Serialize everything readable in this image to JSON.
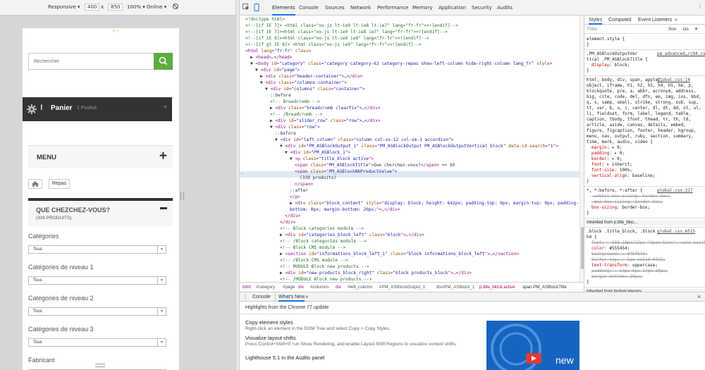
{
  "device_toolbar": {
    "mode": "Responsive ▾",
    "width": "400",
    "times": "x",
    "height": "850",
    "zoom": "100% ▾",
    "network": "Online ▾"
  },
  "tabs": [
    "Elements",
    "Console",
    "Sources",
    "Network",
    "Performance",
    "Memory",
    "Application",
    "Security",
    "Audits"
  ],
  "styles_tabs": [
    "Styles",
    "Computed",
    "Event Listeners",
    "»"
  ],
  "filter_placeholder": "Filter",
  "filter_hov": ":hov",
  "filter_cls": ".cls",
  "filter_plus": "+",
  "device_page": {
    "logo_fragment": "ᵒ⁻ᶦ",
    "search_placeholder": "Rechercher",
    "cart_label": "Panier",
    "cart_count": "1 Produit",
    "menu_label": "MENU",
    "breadcrumb_item": "Repas",
    "filter_title": "QUE CHEZCHEZ-VOUS?",
    "filter_count": "(339 PRODUITS)",
    "filters": [
      {
        "label": "Catégories",
        "value": "Tous"
      },
      {
        "label": "Catégories de niveau 1",
        "value": "Tous"
      },
      {
        "label": "Catégories de niveau 2",
        "value": "Tous"
      },
      {
        "label": "Catégories de niveau 3",
        "value": "Tous"
      },
      {
        "label": "Fabricant",
        "value": "Tous"
      }
    ]
  },
  "dom_lines": [
    [
      {
        "c": "cm",
        "t": "<!doctype html>"
      }
    ],
    [
      {
        "c": "cm",
        "t": "<!--[if IE 7]> <html class=\"no-js lt-ie9 lt-ie8 lt-ie7\" lang=\"fr-fr\"><![endif]-->"
      }
    ],
    [
      {
        "c": "cm",
        "t": "<!--[if IE 7]><html class=\"no-js lt-ie9 lt-ie8 ie7\" lang=\"fr-fr\"><![endif]-->"
      }
    ],
    [
      {
        "c": "cm",
        "t": "<!--[if IE 8]><html class=\"no-js lt-ie9 ie8\" lang=\"fr-fr\"><![endif]-->"
      }
    ],
    [
      {
        "c": "cm",
        "t": "<!--[if gt IE 8]> <html class=\"no-js ie9\" lang=\"fr-fr\"><![endif]-->"
      }
    ],
    [
      {
        "c": "tag",
        "t": "<html "
      },
      {
        "c": "an",
        "t": "lang"
      },
      {
        "c": "tag",
        "t": "="
      },
      {
        "c": "av",
        "t": "\"fr-fr\""
      },
      {
        "c": "tag",
        "t": " "
      },
      {
        "c": "an",
        "t": "class"
      },
      {
        "c": "tag",
        "t": ">"
      }
    ],
    [
      {
        "c": "tx",
        "t": "▶ "
      },
      {
        "c": "tag",
        "t": "<head>…</head>"
      }
    ],
    [
      {
        "c": "tx",
        "t": "▼ "
      },
      {
        "c": "tag",
        "t": "<body "
      },
      {
        "c": "an",
        "t": "id"
      },
      {
        "c": "tag",
        "t": "="
      },
      {
        "c": "av",
        "t": "\"category\""
      },
      {
        "c": "tag",
        "t": " "
      },
      {
        "c": "an",
        "t": "class"
      },
      {
        "c": "tag",
        "t": "="
      },
      {
        "c": "av",
        "t": "\"category category-62 category-repas show-left-column hide-right-column lang_fr\""
      },
      {
        "c": "tag",
        "t": " "
      },
      {
        "c": "an",
        "t": "style"
      },
      {
        "c": "tag",
        "t": ">"
      }
    ],
    [
      {
        "c": "tx",
        "t": "▼ "
      },
      {
        "c": "tag",
        "t": "<div "
      },
      {
        "c": "an",
        "t": "id"
      },
      {
        "c": "tag",
        "t": "="
      },
      {
        "c": "av",
        "t": "\"page\""
      },
      {
        "c": "tag",
        "t": ">"
      }
    ],
    [
      {
        "c": "tx",
        "t": "▶ "
      },
      {
        "c": "tag",
        "t": "<div "
      },
      {
        "c": "an",
        "t": "class"
      },
      {
        "c": "tag",
        "t": "="
      },
      {
        "c": "av",
        "t": "\"header-container\""
      },
      {
        "c": "tag",
        "t": ">…</div>"
      }
    ],
    [
      {
        "c": "tx",
        "t": "▼ "
      },
      {
        "c": "tag",
        "t": "<div "
      },
      {
        "c": "an",
        "t": "class"
      },
      {
        "c": "tag",
        "t": "="
      },
      {
        "c": "av",
        "t": "\"columns-container\""
      },
      {
        "c": "tag",
        "t": ">"
      }
    ],
    [
      {
        "c": "tx",
        "t": "▼ "
      },
      {
        "c": "tag",
        "t": "<div "
      },
      {
        "c": "an",
        "t": "id"
      },
      {
        "c": "tag",
        "t": "="
      },
      {
        "c": "av",
        "t": "\"columns\""
      },
      {
        "c": "tag",
        "t": " "
      },
      {
        "c": "an",
        "t": "class"
      },
      {
        "c": "tag",
        "t": "="
      },
      {
        "c": "av",
        "t": "\"container\""
      },
      {
        "c": "tag",
        "t": ">"
      }
    ],
    [
      {
        "c": "tx",
        "t": "::before"
      }
    ],
    [
      {
        "c": "cm",
        "t": "<!-- Breadcrumb -->"
      }
    ],
    [
      {
        "c": "tx",
        "t": "▶ "
      },
      {
        "c": "tag",
        "t": "<div "
      },
      {
        "c": "an",
        "t": "class"
      },
      {
        "c": "tag",
        "t": "="
      },
      {
        "c": "av",
        "t": "\"breadcrumb clearfix\""
      },
      {
        "c": "tag",
        "t": ">…</div>"
      }
    ],
    [
      {
        "c": "cm",
        "t": "<!-- /Breadcrumb -->"
      }
    ],
    [
      {
        "c": "tx",
        "t": "▶ "
      },
      {
        "c": "tag",
        "t": "<div "
      },
      {
        "c": "an",
        "t": "id"
      },
      {
        "c": "tag",
        "t": "="
      },
      {
        "c": "av",
        "t": "\"slider_row\""
      },
      {
        "c": "tag",
        "t": " "
      },
      {
        "c": "an",
        "t": "class"
      },
      {
        "c": "tag",
        "t": "="
      },
      {
        "c": "av",
        "t": "\"row\""
      },
      {
        "c": "tag",
        "t": ">…</div>"
      }
    ],
    [
      {
        "c": "tx",
        "t": "▼ "
      },
      {
        "c": "tag",
        "t": "<div "
      },
      {
        "c": "an",
        "t": "class"
      },
      {
        "c": "tag",
        "t": "="
      },
      {
        "c": "av",
        "t": "\"row\""
      },
      {
        "c": "tag",
        "t": ">"
      }
    ],
    [
      {
        "c": "tx",
        "t": "::before"
      }
    ],
    [
      {
        "c": "tx",
        "t": "▼ "
      },
      {
        "c": "tag",
        "t": "<div "
      },
      {
        "c": "an",
        "t": "id"
      },
      {
        "c": "tag",
        "t": "="
      },
      {
        "c": "av",
        "t": "\"left_column\""
      },
      {
        "c": "tag",
        "t": " "
      },
      {
        "c": "an",
        "t": "class"
      },
      {
        "c": "tag",
        "t": "="
      },
      {
        "c": "av",
        "t": "\"column col-xs-12 col-sm-3 accordion\""
      },
      {
        "c": "tag",
        "t": ">"
      }
    ],
    [
      {
        "c": "tx",
        "t": "▼ "
      },
      {
        "c": "tag",
        "t": "<div "
      },
      {
        "c": "an",
        "t": "id"
      },
      {
        "c": "tag",
        "t": "="
      },
      {
        "c": "av",
        "t": "\"PM_ASBlockOutput_1\""
      },
      {
        "c": "tag",
        "t": " "
      },
      {
        "c": "an",
        "t": "class"
      },
      {
        "c": "tag",
        "t": "="
      },
      {
        "c": "av",
        "t": "\"PM_ASBlockOutput PM_ASBlockOutputVertical block\""
      },
      {
        "c": "tag",
        "t": " "
      },
      {
        "c": "an",
        "t": "data-id-search"
      },
      {
        "c": "tag",
        "t": "="
      },
      {
        "c": "av",
        "t": "\"1\""
      },
      {
        "c": "tag",
        "t": ">"
      }
    ],
    [
      {
        "c": "tx",
        "t": "▼ "
      },
      {
        "c": "tag",
        "t": "<div "
      },
      {
        "c": "an",
        "t": "id"
      },
      {
        "c": "tag",
        "t": "="
      },
      {
        "c": "av",
        "t": "\"PM_ASBlock_1\""
      },
      {
        "c": "tag",
        "t": ">"
      }
    ],
    [
      {
        "c": "tx",
        "t": "▼ "
      },
      {
        "c": "tag",
        "t": "<p "
      },
      {
        "c": "an",
        "t": "class"
      },
      {
        "c": "tag",
        "t": "="
      },
      {
        "c": "av",
        "t": "\"title_block active\""
      },
      {
        "c": "tag",
        "t": ">"
      }
    ],
    [
      {
        "c": "tag",
        "t": "<span "
      },
      {
        "c": "an",
        "t": "class"
      },
      {
        "c": "tag",
        "t": "="
      },
      {
        "c": "av",
        "t": "\"PM_ASBlockTitle\""
      },
      {
        "c": "tag",
        "t": ">"
      },
      {
        "c": "tx",
        "t": "Que cherchez-vous?"
      },
      {
        "c": "tag",
        "t": "</span>"
      },
      {
        "c": "tx",
        "t": " == $0"
      }
    ],
    [
      {
        "c": "tag",
        "t": "<span "
      },
      {
        "c": "an",
        "t": "class"
      },
      {
        "c": "tag",
        "t": "="
      },
      {
        "c": "av",
        "t": "\"PM_ASBlockNbProductValue\""
      },
      {
        "c": "tag",
        "t": ">"
      }
    ],
    [
      {
        "c": "tx",
        "t": "(339 produits)"
      }
    ],
    [
      {
        "c": "tag",
        "t": "</span>"
      }
    ],
    [
      {
        "c": "tx",
        "t": "::after"
      }
    ],
    [
      {
        "c": "tag",
        "t": "</p>"
      }
    ],
    [
      {
        "c": "tx",
        "t": "▶ "
      },
      {
        "c": "tag",
        "t": "<div "
      },
      {
        "c": "an",
        "t": "class"
      },
      {
        "c": "tag",
        "t": "="
      },
      {
        "c": "av",
        "t": "\"block_content\""
      },
      {
        "c": "tag",
        "t": " "
      },
      {
        "c": "an",
        "t": "style"
      },
      {
        "c": "tag",
        "t": "="
      },
      {
        "c": "av",
        "t": "\"display: block; height: 642px; padding-top: 0px; margin-top: 0px; padding-"
      }
    ],
    [
      {
        "c": "av",
        "t": "bottom: 0px; margin-bottom: 20px;\""
      },
      {
        "c": "tag",
        "t": ">…</div>"
      }
    ],
    [
      {
        "c": "tag",
        "t": "</div>"
      }
    ],
    [
      {
        "c": "tag",
        "t": "</div>"
      }
    ],
    [
      {
        "c": "cm",
        "t": "<!-- Block categories module -->"
      }
    ],
    [
      {
        "c": "tx",
        "t": "▶ "
      },
      {
        "c": "tag",
        "t": "<div "
      },
      {
        "c": "an",
        "t": "id"
      },
      {
        "c": "tag",
        "t": "="
      },
      {
        "c": "av",
        "t": "\"categories_block_left\""
      },
      {
        "c": "tag",
        "t": " "
      },
      {
        "c": "an",
        "t": "class"
      },
      {
        "c": "tag",
        "t": "="
      },
      {
        "c": "av",
        "t": "\"block\""
      },
      {
        "c": "tag",
        "t": ">…</div>"
      }
    ],
    [
      {
        "c": "cm",
        "t": "<!-- /Block categories module -->"
      }
    ],
    [
      {
        "c": "cm",
        "t": "<!-- Block CMS module -->"
      }
    ],
    [
      {
        "c": "tx",
        "t": "▶ "
      },
      {
        "c": "tag",
        "t": "<section "
      },
      {
        "c": "an",
        "t": "id"
      },
      {
        "c": "tag",
        "t": "="
      },
      {
        "c": "av",
        "t": "\"informations_block_left_1\""
      },
      {
        "c": "tag",
        "t": " "
      },
      {
        "c": "an",
        "t": "class"
      },
      {
        "c": "tag",
        "t": "="
      },
      {
        "c": "av",
        "t": "\"block informations_block_left\""
      },
      {
        "c": "tag",
        "t": ">…</section>"
      }
    ],
    [
      {
        "c": "cm",
        "t": "<!-- /Block CMS module -->"
      }
    ],
    [
      {
        "c": "cm",
        "t": "<!-- MODULE Block new products -->"
      }
    ],
    [
      {
        "c": "tx",
        "t": "▶ "
      },
      {
        "c": "tag",
        "t": "<div "
      },
      {
        "c": "an",
        "t": "id"
      },
      {
        "c": "tag",
        "t": "="
      },
      {
        "c": "av",
        "t": "\"new-products_block_right\""
      },
      {
        "c": "tag",
        "t": " "
      },
      {
        "c": "an",
        "t": "class"
      },
      {
        "c": "tag",
        "t": "="
      },
      {
        "c": "av",
        "t": "\"block products_block\""
      },
      {
        "c": "tag",
        "t": ">…</div>"
      }
    ],
    [
      {
        "c": "cm",
        "t": "<!-- /MODULE Block new products -->"
      }
    ],
    [
      {
        "c": "cm",
        "t": "<!-- Block stores module -->"
      }
    ]
  ],
  "dom_indent": [
    0,
    0,
    0,
    0,
    0,
    0,
    1,
    1,
    2,
    3,
    3,
    4,
    5,
    5,
    5,
    5,
    5,
    5,
    6,
    6,
    7,
    8,
    9,
    10,
    10,
    11,
    10,
    9,
    9,
    9,
    9,
    8,
    7,
    7,
    7,
    7,
    7,
    7,
    7,
    7,
    7,
    7
  ],
  "breadcrumb": [
    "html",
    "#category",
    "#page",
    "div",
    "#columns",
    "div",
    "#left_column",
    "#PM_ASBlockOutput_1",
    "div#PM_ASBlock_1",
    "p.title_block.active",
    "span.PM_ASBlockTitle"
  ],
  "drawer": {
    "tabs": [
      "Console",
      "What's New"
    ],
    "close": "×",
    "header": "Highlights from the Chrome 77 update",
    "items": [
      {
        "title": "Copy element styles",
        "desc": "Right-click an element in the DOM Tree and select Copy > Copy Styles."
      },
      {
        "title": "Visualize layout shifts",
        "desc": "Press Control+Shift+P, run Show Rendering, and enable Layout Shift Regions to visualize content shifts."
      },
      {
        "title": "Lighthouse 5.1 in the Audits panel",
        "desc": ""
      }
    ],
    "video_label": "new"
  },
  "styles_lines": [
    {
      "t": "element.style {",
      "c": "pv"
    },
    {
      "t": "}",
      "c": "pv"
    },
    {
      "sep": true
    },
    {
      "t": ".PM_ASBlockOutputVer",
      "c": "pv",
      "src": "pm_advanced…rch4.css:35"
    },
    {
      "t": "tical .PM_ASBlockTitle {",
      "c": "pv"
    },
    {
      "p": "display",
      "v": "block;"
    },
    {
      "t": "}",
      "c": "pv"
    },
    {
      "sep": true
    },
    {
      "t": "html, body, div, span, applet,",
      "c": "pv",
      "src": "global.css:14"
    },
    {
      "t": "object, iframe, h1, h2, h3, h4, h5, h6, p,",
      "c": "pv"
    },
    {
      "t": "blockquote, pre, a, abbr, acronym, address,",
      "c": "pv"
    },
    {
      "t": "big, cite, code, del, dfn, em, img, ins, kbd,",
      "c": "pv"
    },
    {
      "t": "q, s, samp, small, strike, strong, sub, sup,",
      "c": "pv"
    },
    {
      "t": "tt, var, b, u, i, center, dl, dt, dd, ol, ul,",
      "c": "pv"
    },
    {
      "t": "li, fieldset, form, label, legend, table,",
      "c": "pv"
    },
    {
      "t": "caption, tbody, tfoot, thead, tr, th, td,",
      "c": "pv"
    },
    {
      "t": "article, aside, canvas, details, embed,",
      "c": "pv"
    },
    {
      "t": "figure, figcaption, footer, header, hgroup,",
      "c": "pv"
    },
    {
      "t": "menu, nav, output, ruby, section, summary,",
      "c": "pv"
    },
    {
      "t": "time, mark, audio, video {",
      "c": "pv"
    },
    {
      "p": "margin",
      "v": "▸ 0;"
    },
    {
      "p": "padding",
      "v": "▸ 0;"
    },
    {
      "p": "border",
      "v": "▸ 0;"
    },
    {
      "p": "font",
      "v": "▸ inherit;"
    },
    {
      "p": "font-size",
      "v": "100%;"
    },
    {
      "p": "vertical-align",
      "v": "baseline;"
    },
    {
      "t": "}",
      "c": "pv"
    },
    {
      "sep": true
    },
    {
      "t": "*, *:before, *:after {",
      "c": "pv",
      "src": "global.css:227"
    },
    {
      "p": "-webkit-box-sizing",
      "v": "border-box;",
      "strike": true
    },
    {
      "p": "-moz-box-sizing",
      "v": "border-box;",
      "strike": true
    },
    {
      "p": "box-sizing",
      "v": "border-box;"
    },
    {
      "t": "}",
      "c": "pv"
    },
    {
      "sep": true
    },
    {
      "t": "Inherited from p.title_bloc…",
      "c": "src2"
    },
    {
      "sep": true
    },
    {
      "t": ".block .title_block, .block",
      "c": "pv",
      "src": "global.css:6515"
    },
    {
      "t": "h4 {",
      "c": "pv"
    },
    {
      "p": "font",
      "v": "▸ 600 18px/22px \"Open Sans\", sans-serif;",
      "strike": true
    },
    {
      "p": "color",
      "v": "#555454;"
    },
    {
      "p": "background",
      "v": "▸ #f6f6f6;",
      "strike": true
    },
    {
      "p": "border-top",
      "v": "▸ 5px solid #333;",
      "strike": true
    },
    {
      "p": "text-transform",
      "v": "uppercase;"
    },
    {
      "p": "padding",
      "v": "▸ 14px 5px 17px 20px;",
      "strike": true
    },
    {
      "p": "margin-bottom",
      "v": "20px;",
      "strike": true
    },
    {
      "t": "}",
      "c": "pv"
    },
    {
      "sep": true
    },
    {
      "t": "Inherited from body#category",
      "c": "src2"
    }
  ],
  "colors": {
    "green": "#5eab42",
    "dark": "#333333",
    "accent": "#1a73e8",
    "video_bg": "#1565c0"
  }
}
